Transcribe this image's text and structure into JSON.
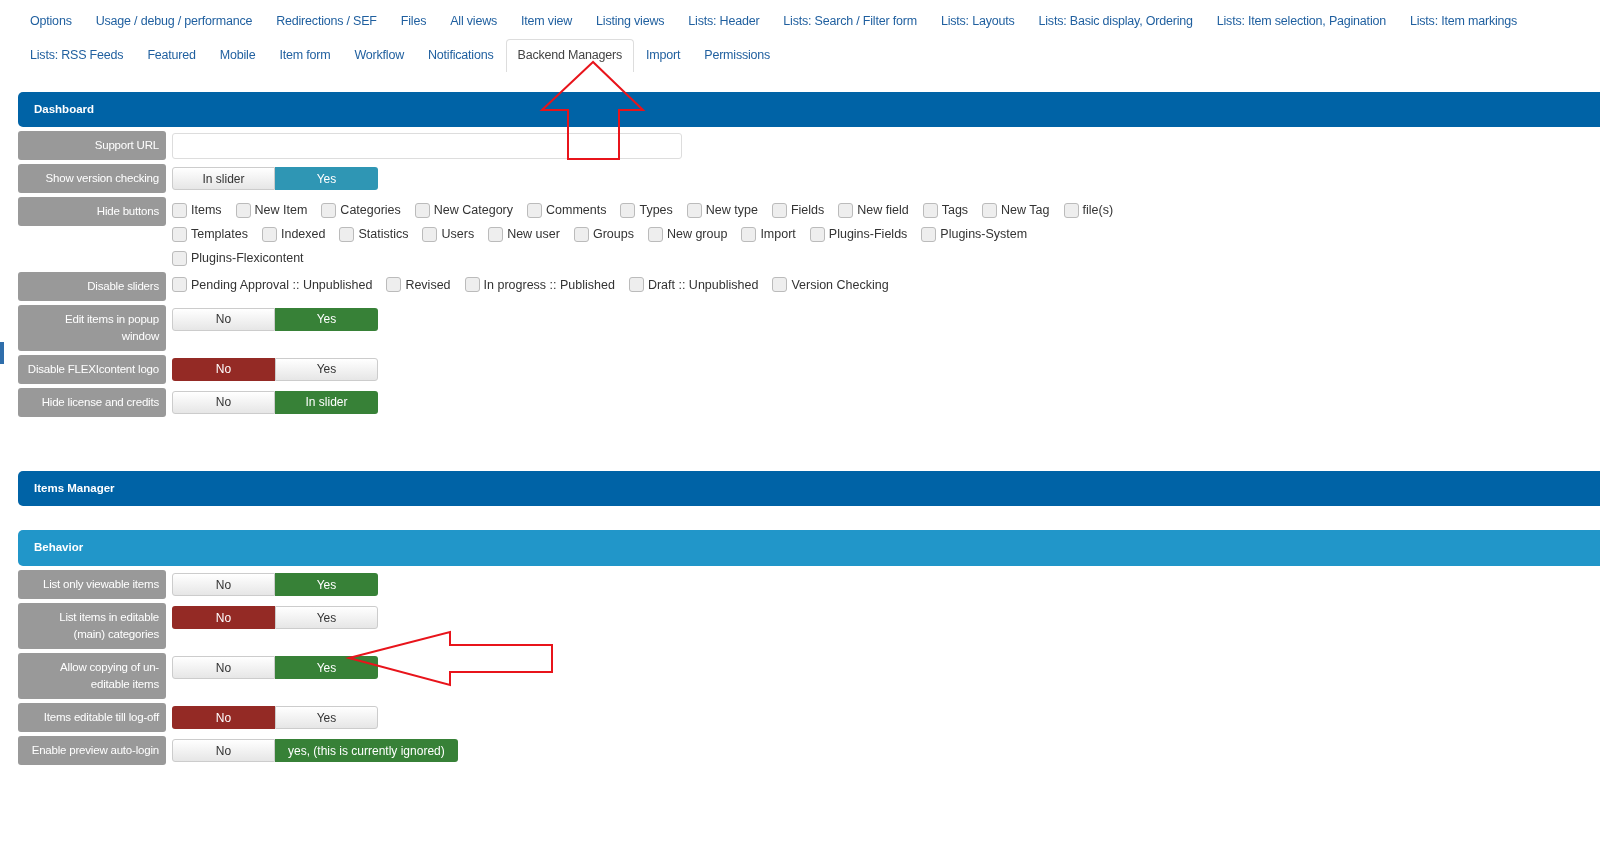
{
  "tabs": [
    {
      "label": "Options",
      "selected": false
    },
    {
      "label": "Usage / debug / performance",
      "selected": false
    },
    {
      "label": "Redirections / SEF",
      "selected": false
    },
    {
      "label": "Files",
      "selected": false
    },
    {
      "label": "All views",
      "selected": false
    },
    {
      "label": "Item view",
      "selected": false
    },
    {
      "label": "Listing views",
      "selected": false
    },
    {
      "label": "Lists: Header",
      "selected": false
    },
    {
      "label": "Lists: Search / Filter form",
      "selected": false
    },
    {
      "label": "Lists: Layouts",
      "selected": false
    },
    {
      "label": "Lists: Basic display, Ordering",
      "selected": false
    },
    {
      "label": "Lists: Item selection, Pagination",
      "selected": false
    },
    {
      "label": "Lists: Item markings",
      "selected": false
    },
    {
      "label": "Lists: RSS Feeds",
      "selected": false
    },
    {
      "label": "Featured",
      "selected": false
    },
    {
      "label": "Mobile",
      "selected": false
    },
    {
      "label": "Item form",
      "selected": false
    },
    {
      "label": "Workflow",
      "selected": false
    },
    {
      "label": "Notifications",
      "selected": false
    },
    {
      "label": "Backend Managers",
      "selected": true
    },
    {
      "label": "Import",
      "selected": false
    },
    {
      "label": "Permissions",
      "selected": false
    }
  ],
  "sections": [
    {
      "kind": "header",
      "title": "Dashboard",
      "rows": [
        {
          "kind": "text",
          "label": "Support URL"
        },
        {
          "kind": "toggle",
          "label": "Show version checking",
          "options": [
            {
              "label": "In slider",
              "selected": false
            },
            {
              "label": "Yes",
              "selected": true,
              "color": "#2f96b4"
            }
          ]
        },
        {
          "kind": "checkboxes",
          "label": "Hide buttons",
          "options": [
            {
              "label": "Items",
              "checked": false
            },
            {
              "label": "New Item",
              "checked": false
            },
            {
              "label": "Categories",
              "checked": false
            },
            {
              "label": "New Category",
              "checked": false
            },
            {
              "label": "Comments",
              "checked": false
            },
            {
              "label": "Types",
              "checked": false
            },
            {
              "label": "New type",
              "checked": false
            },
            {
              "label": "Fields",
              "checked": false
            },
            {
              "label": "New field",
              "checked": false
            },
            {
              "label": "Tags",
              "checked": false
            },
            {
              "label": "New Tag",
              "checked": false
            },
            {
              "label": "file(s)",
              "checked": false
            },
            {
              "label": "Templates",
              "checked": false
            },
            {
              "label": "Indexed",
              "checked": false
            },
            {
              "label": "Statistics",
              "checked": false
            },
            {
              "label": "Users",
              "checked": false
            },
            {
              "label": "New user",
              "checked": false
            },
            {
              "label": "Groups",
              "checked": false
            },
            {
              "label": "New group",
              "checked": false
            },
            {
              "label": "Import",
              "checked": false
            },
            {
              "label": "Plugins-Fields",
              "checked": false
            },
            {
              "label": "Plugins-System",
              "checked": false
            },
            {
              "label": "Plugins-Flexicontent",
              "checked": false
            }
          ]
        },
        {
          "kind": "checkboxes",
          "label": "Disable sliders",
          "options": [
            {
              "label": "Pending Approval :: Unpublished",
              "checked": false
            },
            {
              "label": "Revised",
              "checked": false
            },
            {
              "label": "In progress :: Published",
              "checked": false
            },
            {
              "label": "Draft :: Unpublished",
              "checked": false
            },
            {
              "label": "Version Checking",
              "checked": false
            }
          ]
        },
        {
          "kind": "toggle",
          "label": "Edit items in popup window",
          "options": [
            {
              "label": "No",
              "selected": false
            },
            {
              "label": "Yes",
              "selected": true,
              "color": "#378137"
            }
          ]
        },
        {
          "kind": "toggle",
          "label": "Disable FLEXIcontent logo",
          "options": [
            {
              "label": "No",
              "selected": true,
              "color": "#942a25"
            },
            {
              "label": "Yes",
              "selected": false
            }
          ]
        },
        {
          "kind": "toggle",
          "label": "Hide license and credits",
          "options": [
            {
              "label": "No",
              "selected": false
            },
            {
              "label": "In slider",
              "selected": true,
              "color": "#378137"
            }
          ]
        }
      ]
    },
    {
      "kind": "header",
      "title": "Items Manager"
    },
    {
      "kind": "subheader",
      "title": "Behavior",
      "rows": [
        {
          "kind": "toggle",
          "label": "List only viewable items",
          "options": [
            {
              "label": "No",
              "selected": false
            },
            {
              "label": "Yes",
              "selected": true,
              "color": "#378137"
            }
          ]
        },
        {
          "kind": "toggle",
          "label": "List items in editable (main) categories",
          "options": [
            {
              "label": "No",
              "selected": true,
              "color": "#942a25"
            },
            {
              "label": "Yes",
              "selected": false
            }
          ]
        },
        {
          "kind": "toggle",
          "label": "Allow copying of un-editable items",
          "options": [
            {
              "label": "No",
              "selected": false
            },
            {
              "label": "Yes",
              "selected": true,
              "color": "#378137"
            }
          ]
        },
        {
          "kind": "toggle",
          "label": "Items editable till log-off",
          "options": [
            {
              "label": "No",
              "selected": true,
              "color": "#942a25"
            },
            {
              "label": "Yes",
              "selected": false
            }
          ]
        },
        {
          "kind": "toggle",
          "label": "Enable preview auto-login",
          "options": [
            {
              "label": "No",
              "selected": false
            },
            {
              "label": "yes, (this is currently ignored)",
              "selected": true,
              "color": "#378137"
            }
          ]
        }
      ]
    }
  ]
}
